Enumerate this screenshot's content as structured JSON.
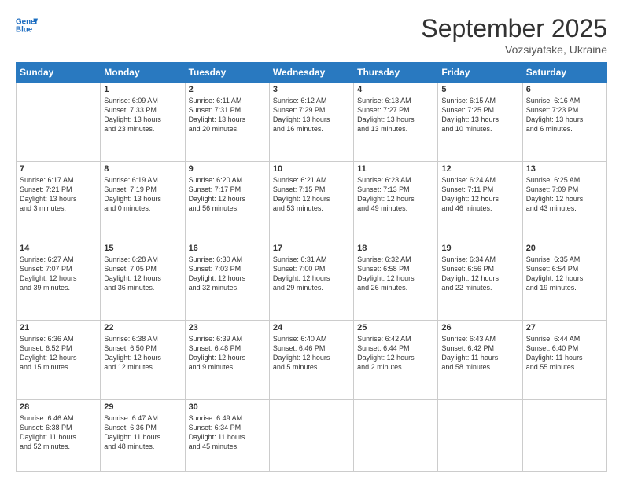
{
  "logo": {
    "line1": "General",
    "line2": "Blue"
  },
  "title": "September 2025",
  "location": "Vozsiyatske, Ukraine",
  "days_of_week": [
    "Sunday",
    "Monday",
    "Tuesday",
    "Wednesday",
    "Thursday",
    "Friday",
    "Saturday"
  ],
  "weeks": [
    [
      {
        "day": "",
        "info": ""
      },
      {
        "day": "1",
        "info": "Sunrise: 6:09 AM\nSunset: 7:33 PM\nDaylight: 13 hours\nand 23 minutes."
      },
      {
        "day": "2",
        "info": "Sunrise: 6:11 AM\nSunset: 7:31 PM\nDaylight: 13 hours\nand 20 minutes."
      },
      {
        "day": "3",
        "info": "Sunrise: 6:12 AM\nSunset: 7:29 PM\nDaylight: 13 hours\nand 16 minutes."
      },
      {
        "day": "4",
        "info": "Sunrise: 6:13 AM\nSunset: 7:27 PM\nDaylight: 13 hours\nand 13 minutes."
      },
      {
        "day": "5",
        "info": "Sunrise: 6:15 AM\nSunset: 7:25 PM\nDaylight: 13 hours\nand 10 minutes."
      },
      {
        "day": "6",
        "info": "Sunrise: 6:16 AM\nSunset: 7:23 PM\nDaylight: 13 hours\nand 6 minutes."
      }
    ],
    [
      {
        "day": "7",
        "info": "Sunrise: 6:17 AM\nSunset: 7:21 PM\nDaylight: 13 hours\nand 3 minutes."
      },
      {
        "day": "8",
        "info": "Sunrise: 6:19 AM\nSunset: 7:19 PM\nDaylight: 13 hours\nand 0 minutes."
      },
      {
        "day": "9",
        "info": "Sunrise: 6:20 AM\nSunset: 7:17 PM\nDaylight: 12 hours\nand 56 minutes."
      },
      {
        "day": "10",
        "info": "Sunrise: 6:21 AM\nSunset: 7:15 PM\nDaylight: 12 hours\nand 53 minutes."
      },
      {
        "day": "11",
        "info": "Sunrise: 6:23 AM\nSunset: 7:13 PM\nDaylight: 12 hours\nand 49 minutes."
      },
      {
        "day": "12",
        "info": "Sunrise: 6:24 AM\nSunset: 7:11 PM\nDaylight: 12 hours\nand 46 minutes."
      },
      {
        "day": "13",
        "info": "Sunrise: 6:25 AM\nSunset: 7:09 PM\nDaylight: 12 hours\nand 43 minutes."
      }
    ],
    [
      {
        "day": "14",
        "info": "Sunrise: 6:27 AM\nSunset: 7:07 PM\nDaylight: 12 hours\nand 39 minutes."
      },
      {
        "day": "15",
        "info": "Sunrise: 6:28 AM\nSunset: 7:05 PM\nDaylight: 12 hours\nand 36 minutes."
      },
      {
        "day": "16",
        "info": "Sunrise: 6:30 AM\nSunset: 7:03 PM\nDaylight: 12 hours\nand 32 minutes."
      },
      {
        "day": "17",
        "info": "Sunrise: 6:31 AM\nSunset: 7:00 PM\nDaylight: 12 hours\nand 29 minutes."
      },
      {
        "day": "18",
        "info": "Sunrise: 6:32 AM\nSunset: 6:58 PM\nDaylight: 12 hours\nand 26 minutes."
      },
      {
        "day": "19",
        "info": "Sunrise: 6:34 AM\nSunset: 6:56 PM\nDaylight: 12 hours\nand 22 minutes."
      },
      {
        "day": "20",
        "info": "Sunrise: 6:35 AM\nSunset: 6:54 PM\nDaylight: 12 hours\nand 19 minutes."
      }
    ],
    [
      {
        "day": "21",
        "info": "Sunrise: 6:36 AM\nSunset: 6:52 PM\nDaylight: 12 hours\nand 15 minutes."
      },
      {
        "day": "22",
        "info": "Sunrise: 6:38 AM\nSunset: 6:50 PM\nDaylight: 12 hours\nand 12 minutes."
      },
      {
        "day": "23",
        "info": "Sunrise: 6:39 AM\nSunset: 6:48 PM\nDaylight: 12 hours\nand 9 minutes."
      },
      {
        "day": "24",
        "info": "Sunrise: 6:40 AM\nSunset: 6:46 PM\nDaylight: 12 hours\nand 5 minutes."
      },
      {
        "day": "25",
        "info": "Sunrise: 6:42 AM\nSunset: 6:44 PM\nDaylight: 12 hours\nand 2 minutes."
      },
      {
        "day": "26",
        "info": "Sunrise: 6:43 AM\nSunset: 6:42 PM\nDaylight: 11 hours\nand 58 minutes."
      },
      {
        "day": "27",
        "info": "Sunrise: 6:44 AM\nSunset: 6:40 PM\nDaylight: 11 hours\nand 55 minutes."
      }
    ],
    [
      {
        "day": "28",
        "info": "Sunrise: 6:46 AM\nSunset: 6:38 PM\nDaylight: 11 hours\nand 52 minutes."
      },
      {
        "day": "29",
        "info": "Sunrise: 6:47 AM\nSunset: 6:36 PM\nDaylight: 11 hours\nand 48 minutes."
      },
      {
        "day": "30",
        "info": "Sunrise: 6:49 AM\nSunset: 6:34 PM\nDaylight: 11 hours\nand 45 minutes."
      },
      {
        "day": "",
        "info": ""
      },
      {
        "day": "",
        "info": ""
      },
      {
        "day": "",
        "info": ""
      },
      {
        "day": "",
        "info": ""
      }
    ]
  ]
}
